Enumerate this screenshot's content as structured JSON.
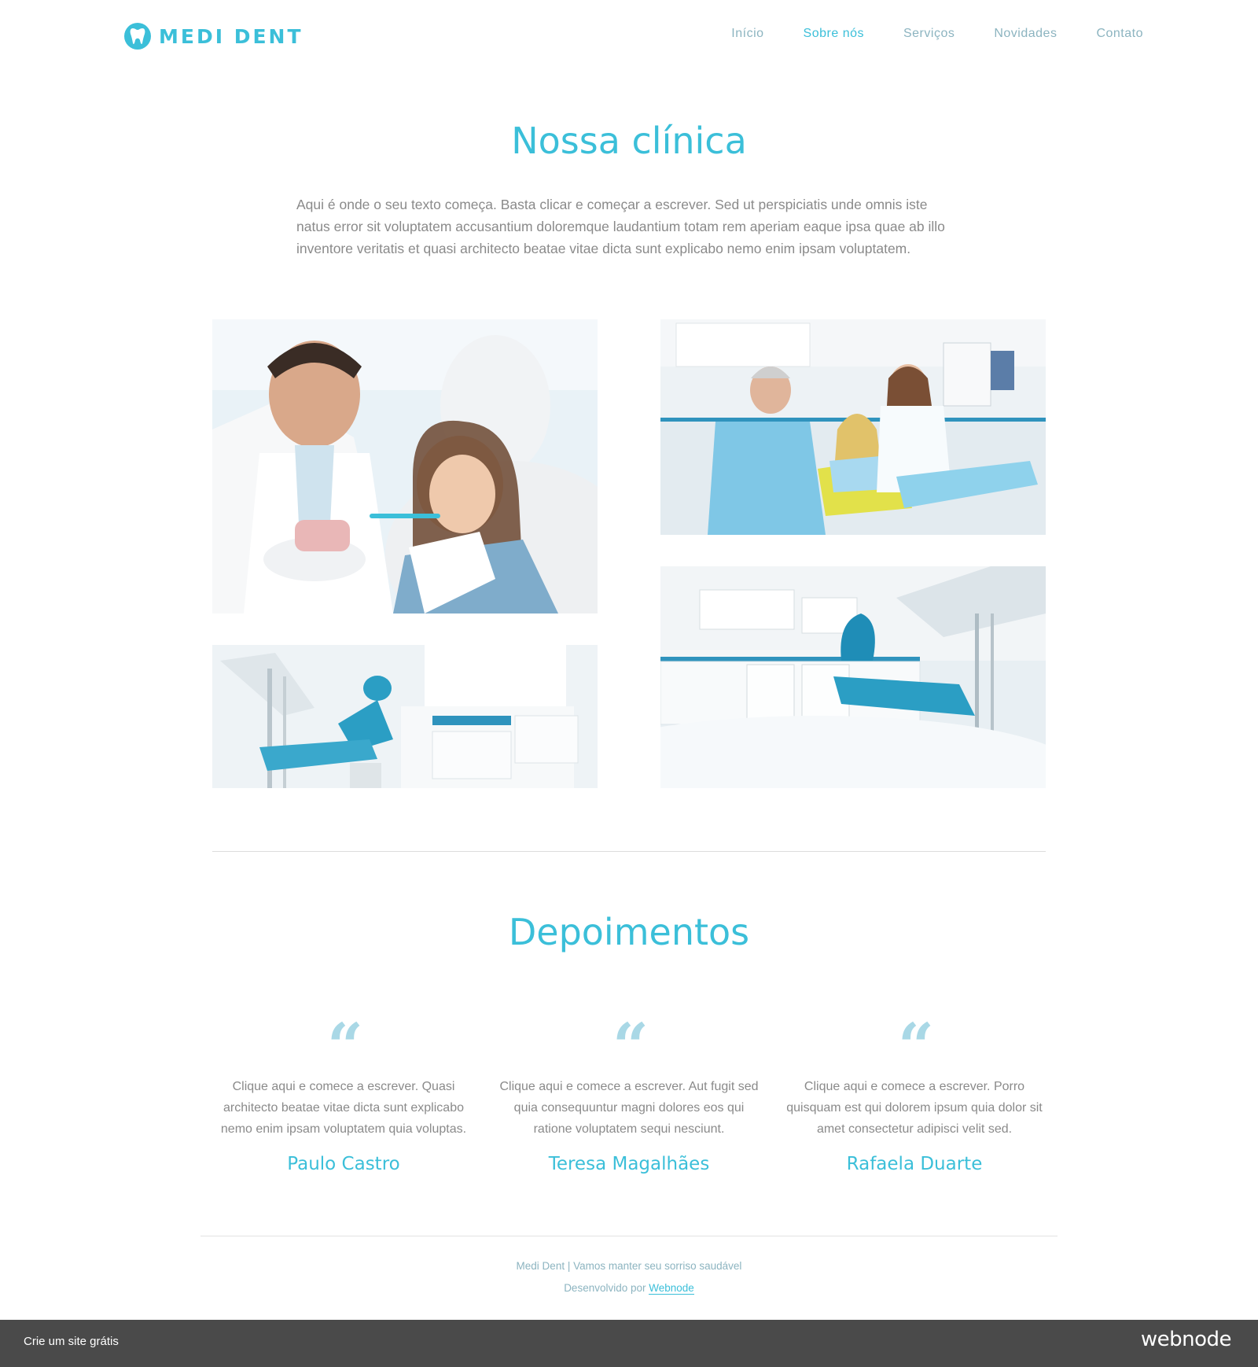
{
  "header": {
    "logo_text": "MEDI DENT",
    "nav": [
      "Início",
      "Sobre nós",
      "Serviços",
      "Novidades",
      "Contato"
    ],
    "active_nav": "Sobre nós"
  },
  "clinic": {
    "title": "Nossa clínica",
    "text": "Aqui é onde o seu texto começa. Basta clicar e começar a escrever. Sed ut perspiciatis unde omnis iste natus error sit voluptatem accusantium doloremque laudantium totam rem aperiam eaque ipsa quae ab illo inventore veritatis et quasi architecto beatae vitae dicta sunt explicabo nemo enim ipsam voluptatem."
  },
  "testimonials": {
    "title": "Depoimentos",
    "quote_mark": "“",
    "items": [
      {
        "text": "Clique aqui e comece a escrever. Quasi architecto beatae vitae dicta sunt explicabo nemo enim ipsam voluptatem quia voluptas.",
        "name": "Paulo Castro"
      },
      {
        "text": "Clique aqui e comece a escrever. Aut fugit sed quia consequuntur magni dolores eos qui ratione voluptatem sequi nesciunt.",
        "name": "Teresa Magalhães"
      },
      {
        "text": "Clique aqui e comece a escrever. Porro quisquam est qui dolorem ipsum quia dolor sit amet consectetur adipisci velit sed.",
        "name": "Rafaela Duarte"
      }
    ]
  },
  "footer": {
    "line1": "Medi Dent | Vamos manter seu sorriso saudável",
    "developed_by": "Desenvolvido por",
    "link": "Webnode"
  },
  "bottom_bar": {
    "left": "Crie um site grátis",
    "brand": "webnode"
  },
  "colors": {
    "accent": "#3bbfd9",
    "nav": "#8cb4c0",
    "text": "#8a8a8a",
    "bar": "#4a4a4a"
  }
}
